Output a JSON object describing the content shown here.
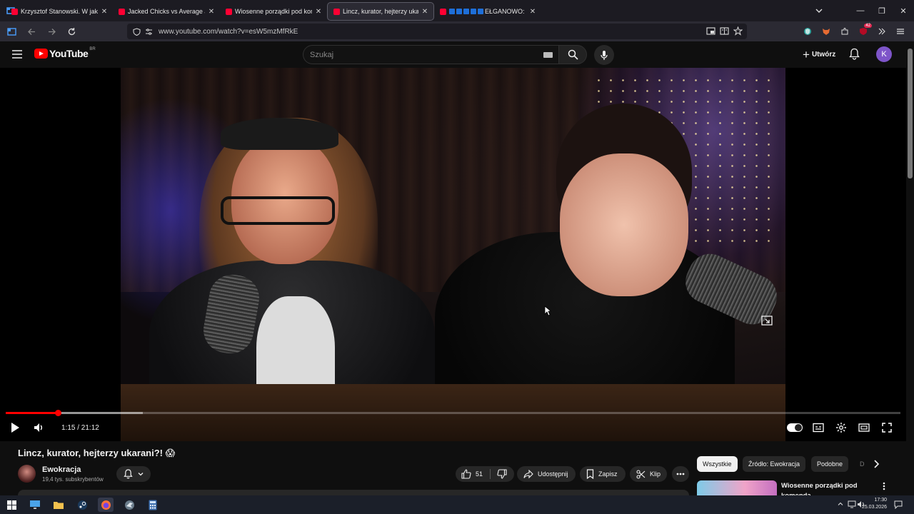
{
  "browser": {
    "tabs": [
      {
        "title": "Krzysztof Stanowski. W jakiej sp",
        "active": false
      },
      {
        "title": "Jacked Chicks vs Average Joes |",
        "active": false
      },
      {
        "title": "Wiosenne porządki pod komen",
        "active": false
      },
      {
        "title": "Lincz, kurator, hejterzy ukarani?!",
        "active": true
      },
      {
        "title": "EŁGANOWO: D",
        "active": false
      }
    ],
    "window_controls": {
      "minimize": "—",
      "restore": "❐",
      "close": "✕"
    },
    "url": "www.youtube.com/watch?v=esW5mzMfRkE",
    "extension_badge": "42"
  },
  "youtube": {
    "logo_text": "YouTube",
    "country_code": "BR",
    "search_placeholder": "Szukaj",
    "create_label": "Utwórz",
    "avatar_letter": "K"
  },
  "player": {
    "current_time": "1:15",
    "duration": "21:12",
    "time_display": "1:15 / 21:12",
    "progress_fraction": 0.059,
    "buffered_fraction": 0.153
  },
  "video": {
    "title": "Lincz, kurator, hejterzy ukarani?! 😱",
    "channel_name": "Ewokracja",
    "subscribers": "19,4 tys. subskrybentów",
    "likes": "51",
    "share_label": "Udostępnij",
    "save_label": "Zapisz",
    "clip_label": "Klip"
  },
  "sidebar": {
    "chips": [
      "Wszystkie",
      "Źródło: Ewokracja",
      "Podobne",
      "D"
    ],
    "related": [
      {
        "title": "Wiosenne porządki pod komenda"
      }
    ]
  },
  "taskbar": {
    "time": "17:30",
    "date": "25.03.2026"
  },
  "colors": {
    "accent_red": "#ff0000",
    "background": "#0f0f0f",
    "avatar": "#7e55c9"
  }
}
